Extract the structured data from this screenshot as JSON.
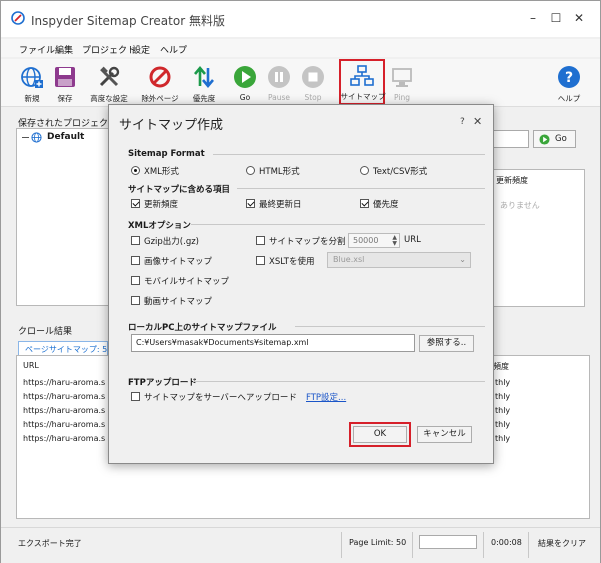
{
  "app": {
    "title": "Inspyder Sitemap Creator 無料版"
  },
  "menu": [
    "ファイル",
    "編集",
    "プロジェクト",
    "設定",
    "ヘルプ"
  ],
  "toolbar": [
    {
      "label": "新規",
      "icon": "globe-new-icon",
      "enabled": true
    },
    {
      "label": "保存",
      "icon": "save-icon",
      "enabled": true
    },
    {
      "label": "高度な設定",
      "icon": "tools-icon",
      "enabled": true
    },
    {
      "label": "除外ページ",
      "icon": "prohibit-icon",
      "enabled": true
    },
    {
      "label": "優先度",
      "icon": "priority-arrows-icon",
      "enabled": true
    },
    {
      "label": "Go",
      "icon": "play-icon",
      "enabled": true
    },
    {
      "label": "Pause",
      "icon": "pause-icon",
      "enabled": false
    },
    {
      "label": "Stop",
      "icon": "stop-icon",
      "enabled": false
    },
    {
      "label": "サイトマップ",
      "icon": "sitemap-icon",
      "enabled": true,
      "highlighted": true
    },
    {
      "label": "Ping",
      "icon": "ping-monitor-icon",
      "enabled": false
    },
    {
      "label": "ヘルプ",
      "icon": "help-icon",
      "enabled": true
    }
  ],
  "projects": {
    "label": "保存されたプロジェクト",
    "items": [
      "Default"
    ]
  },
  "right_panel": {
    "go_label": "Go",
    "column_header": "更新頻度",
    "empty_text": "ありません"
  },
  "crawl": {
    "label": "クロール結果",
    "tab": "ページサイトマップ: 5",
    "url_header": "URL",
    "freq_header": "頻度",
    "rows": [
      {
        "url": "https://haru-aroma.s",
        "freq": "thly"
      },
      {
        "url": "https://haru-aroma.s",
        "freq": "thly"
      },
      {
        "url": "https://haru-aroma.s",
        "freq": "thly"
      },
      {
        "url": "https://haru-aroma.s",
        "freq": "thly"
      },
      {
        "url": "https://haru-aroma.s",
        "freq": "thly"
      }
    ]
  },
  "status": {
    "left": "エクスポート完了",
    "page_limit": "Page Limit: 50",
    "progress_fraction": 0,
    "time": "0:00:08",
    "clear": "結果をクリア"
  },
  "dialog": {
    "title": "サイトマップ作成",
    "help": "?",
    "format": {
      "heading": "Sitemap Format",
      "options": [
        "XML形式",
        "HTML形式",
        "Text/CSV形式"
      ],
      "selected": "XML形式"
    },
    "include": {
      "heading": "サイトマップに含める項目",
      "items": [
        {
          "label": "更新頻度",
          "checked": true
        },
        {
          "label": "最終更新日",
          "checked": true
        },
        {
          "label": "優先度",
          "checked": true
        }
      ]
    },
    "xml": {
      "heading": "XMLオプション",
      "gzip": {
        "label": "Gzip出力(.gz)",
        "checked": false
      },
      "split": {
        "label": "サイトマップを分割",
        "checked": false,
        "value": "50000",
        "unit": "URL"
      },
      "image": {
        "label": "画像サイトマップ",
        "checked": false
      },
      "xslt": {
        "label": "XSLTを使用",
        "checked": false,
        "value": "Blue.xsl"
      },
      "mobile": {
        "label": "モバイルサイトマップ",
        "checked": false
      },
      "video": {
        "label": "動画サイトマップ",
        "checked": false
      }
    },
    "local": {
      "heading": "ローカルPC上のサイトマップファイル",
      "path": "C:¥Users¥masak¥Documents¥sitemap.xml",
      "browse": "参照する.."
    },
    "ftp": {
      "heading": "FTPアップロード",
      "upload": {
        "label": "サイトマップをサーバーへアップロード",
        "checked": false
      },
      "settings": "FTP設定..."
    },
    "ok": "OK",
    "cancel": "キャンセル"
  },
  "colors": {
    "highlight": "#d6202a",
    "go_green": "#3aa63a",
    "stop_red": "#d0282c",
    "link": "#1a55c8",
    "help_blue": "#1f6fd0"
  }
}
